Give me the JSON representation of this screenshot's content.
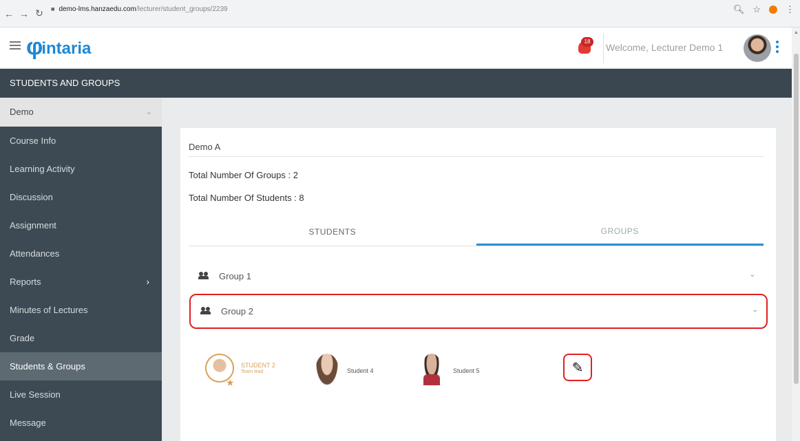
{
  "browser": {
    "url_host": "demo-lms.hanzaedu.com",
    "url_path": "/lecturer/student_groups/2239"
  },
  "header": {
    "logo_text": "intaria",
    "notification_count": "18",
    "welcome_text": "Welcome, Lecturer Demo 1"
  },
  "banner": {
    "title": "STUDENTS AND GROUPS"
  },
  "sidebar": {
    "course": "Demo",
    "items": [
      {
        "label": "Course Info"
      },
      {
        "label": "Learning Activity"
      },
      {
        "label": "Discussion"
      },
      {
        "label": "Assignment"
      },
      {
        "label": "Attendances"
      },
      {
        "label": "Reports"
      },
      {
        "label": "Minutes of Lectures"
      },
      {
        "label": "Grade"
      },
      {
        "label": "Students & Groups"
      },
      {
        "label": "Live Session"
      },
      {
        "label": "Message"
      }
    ],
    "active_item": "Students & Groups"
  },
  "main": {
    "course_name": "Demo A",
    "total_groups": "Total Number Of Groups : 2",
    "total_students": "Total Number Of Students : 8",
    "tabs": [
      {
        "label": "STUDENTS"
      },
      {
        "label": "GROUPS"
      }
    ],
    "active_tab": "GROUPS",
    "groups": [
      {
        "label": "Group 1"
      },
      {
        "label": "Group 2"
      }
    ],
    "members": [
      {
        "name": "STUDENT 2",
        "role": "Team lead"
      },
      {
        "name": "Student 4"
      },
      {
        "name": "Student 5"
      }
    ]
  },
  "colors": {
    "accent": "#2a8fd6",
    "sidebar_bg": "#3d4a53",
    "highlight": "#e02020",
    "leader": "#d9a15a"
  }
}
